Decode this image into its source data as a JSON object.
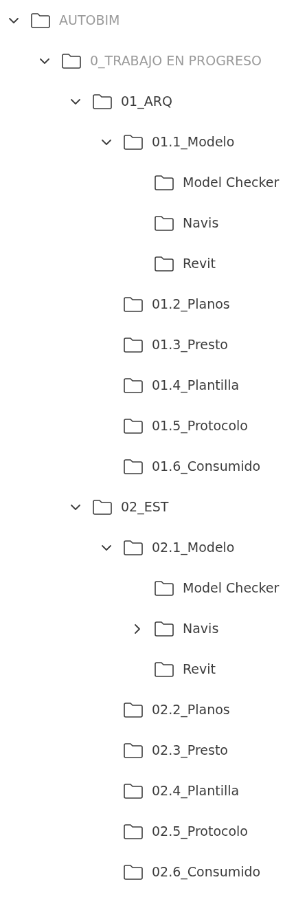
{
  "tree": [
    {
      "label": "AUTOBIM",
      "dimmed": true,
      "expanded": true,
      "children": [
        {
          "label": "0_TRABAJO EN PROGRESO",
          "dimmed": true,
          "expanded": true,
          "children": [
            {
              "label": "01_ARQ",
              "dimmed": false,
              "expanded": true,
              "children": [
                {
                  "label": "01.1_Modelo",
                  "dimmed": false,
                  "expanded": true,
                  "children": [
                    {
                      "label": "Model Checker",
                      "dimmed": false
                    },
                    {
                      "label": "Navis",
                      "dimmed": false
                    },
                    {
                      "label": "Revit",
                      "dimmed": false
                    }
                  ]
                },
                {
                  "label": "01.2_Planos",
                  "dimmed": false
                },
                {
                  "label": "01.3_Presto",
                  "dimmed": false
                },
                {
                  "label": "01.4_Plantilla",
                  "dimmed": false
                },
                {
                  "label": "01.5_Protocolo",
                  "dimmed": false
                },
                {
                  "label": "01.6_Consumido",
                  "dimmed": false
                }
              ]
            },
            {
              "label": "02_EST",
              "dimmed": false,
              "expanded": true,
              "children": [
                {
                  "label": "02.1_Modelo",
                  "dimmed": false,
                  "expanded": true,
                  "children": [
                    {
                      "label": "Model Checker",
                      "dimmed": false
                    },
                    {
                      "label": "Navis",
                      "dimmed": false,
                      "expanded": false
                    },
                    {
                      "label": "Revit",
                      "dimmed": false
                    }
                  ]
                },
                {
                  "label": "02.2_Planos",
                  "dimmed": false
                },
                {
                  "label": "02.3_Presto",
                  "dimmed": false
                },
                {
                  "label": "02.4_Plantilla",
                  "dimmed": false
                },
                {
                  "label": "02.5_Protocolo",
                  "dimmed": false
                },
                {
                  "label": "02.6_Consumido",
                  "dimmed": false
                }
              ]
            }
          ]
        }
      ]
    }
  ]
}
